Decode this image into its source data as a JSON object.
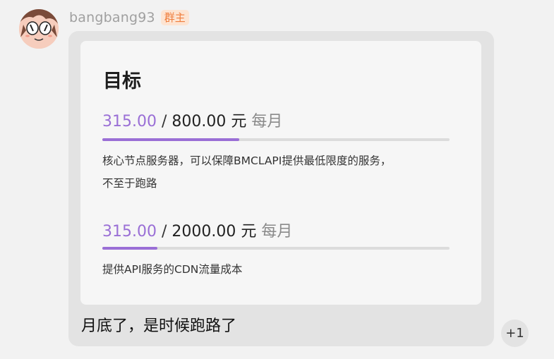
{
  "message": {
    "username": "bangbang93",
    "role_badge": "群主",
    "text": "月底了，是时候跑路了"
  },
  "goal_card": {
    "title": "目标",
    "goals": [
      {
        "current": "315.00",
        "separator": " / ",
        "target": "800.00",
        "currency": " 元",
        "period": " 每月",
        "progress": 0.394,
        "description_lines": [
          "核心节点服务器，可以保障BMCLAPI提供最低限度的服务，",
          "不至于跑路"
        ]
      },
      {
        "current": "315.00",
        "separator": " / ",
        "target": "2000.00",
        "currency": " 元",
        "period": " 每月",
        "progress": 0.158,
        "description_lines": [
          "提供API服务的CDN流量成本"
        ]
      }
    ]
  },
  "reaction": {
    "label": "+1"
  },
  "colors": {
    "accent": "#9a6fd6",
    "badge_text": "#ef7d3c",
    "badge_bg": "#fde4d2",
    "bubble_bg": "#e3e3e3",
    "card_bg": "#f6f6f6"
  },
  "icons": {
    "avatar": "anime-face-avatar"
  }
}
